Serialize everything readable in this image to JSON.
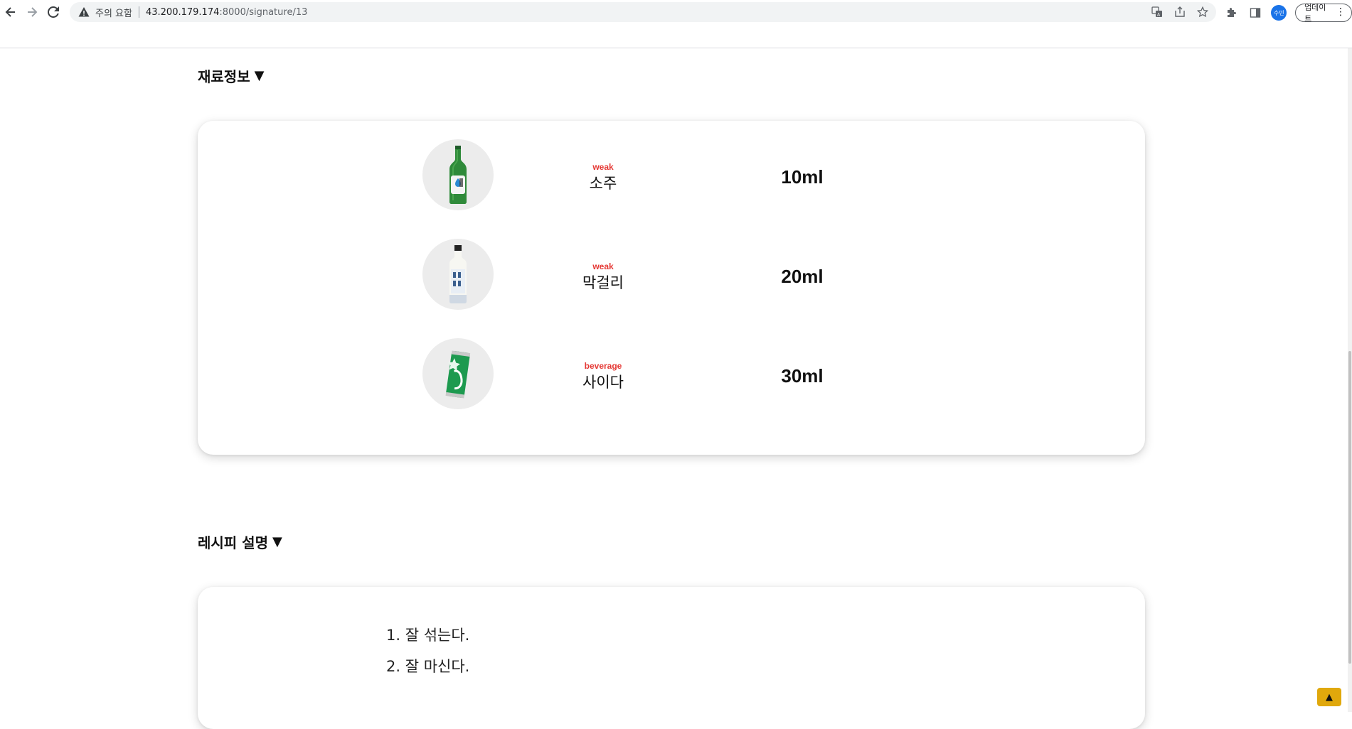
{
  "browser": {
    "security_warning": "주의 요함",
    "url_host": "43.200.179.174",
    "url_path": ":8000/signature/13",
    "profile_initials": "수민",
    "update_label": "업데이트",
    "menu_glyph": "⋮"
  },
  "ingredients": {
    "title": "재료정보",
    "toggle_glyph": "▼",
    "items": [
      {
        "category": "weak",
        "name": "소주",
        "amount": "10ml",
        "image": "soju-bottle-icon"
      },
      {
        "category": "weak",
        "name": "막걸리",
        "amount": "20ml",
        "image": "makgeolli-bottle-icon"
      },
      {
        "category": "beverage",
        "name": "사이다",
        "amount": "30ml",
        "image": "cider-can-icon"
      }
    ]
  },
  "recipe": {
    "title": "레시피 설명",
    "toggle_glyph": "▼",
    "steps": [
      "1. 잘 섞는다.",
      "2. 잘 마신다."
    ]
  },
  "scroll_top_glyph": "▲",
  "colors": {
    "category": "#e53935",
    "scroll_top_bg": "#e0a80c",
    "thumb_bg": "#ececec"
  }
}
